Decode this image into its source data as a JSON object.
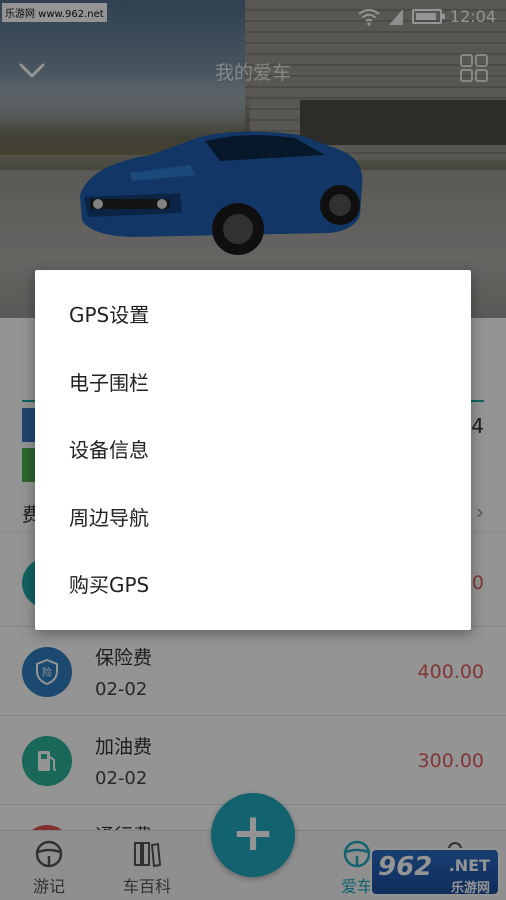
{
  "status_bar": {
    "time": "12:04",
    "battery_level": 0.9,
    "icons": [
      "wifi-icon",
      "signal-icon",
      "battery-icon"
    ]
  },
  "watermark_top": "乐游网 www.962.net",
  "header": {
    "title": "我的爱车"
  },
  "stats": {
    "value": "4"
  },
  "fee_section": {
    "title": "费"
  },
  "fee_list": [
    {
      "name": "",
      "date": "",
      "amount": "0",
      "icon": "generic-icon",
      "color": "#1fa9a9"
    },
    {
      "name": "保险费",
      "date": "02-02",
      "amount": "400.00",
      "icon": "shield-icon",
      "color": "#2f7fc1"
    },
    {
      "name": "加油费",
      "date": "02-02",
      "amount": "300.00",
      "icon": "fuel-pump-icon",
      "color": "#2bb39a"
    },
    {
      "name": "通行费",
      "date": "",
      "amount": "",
      "icon": "toll-icon",
      "color": "#e05050"
    }
  ],
  "bottom_nav": {
    "items": [
      {
        "label": "游记",
        "icon": "steering-wheel-icon"
      },
      {
        "label": "车百科",
        "icon": "books-icon"
      },
      {
        "label": "爱车",
        "icon": "steering-wheel-icon"
      },
      {
        "label": "",
        "icon": "user-icon"
      }
    ],
    "fab_label": "+"
  },
  "watermark_bottom": {
    "big": "962",
    "net": ".NET",
    "cn": "乐游网"
  },
  "menu": {
    "items": [
      {
        "label": "GPS设置"
      },
      {
        "label": "电子围栏"
      },
      {
        "label": "设备信息"
      },
      {
        "label": "周边导航"
      },
      {
        "label": "购买GPS"
      }
    ]
  },
  "colors": {
    "accent": "#1fa9c0",
    "amount": "#e06060"
  }
}
